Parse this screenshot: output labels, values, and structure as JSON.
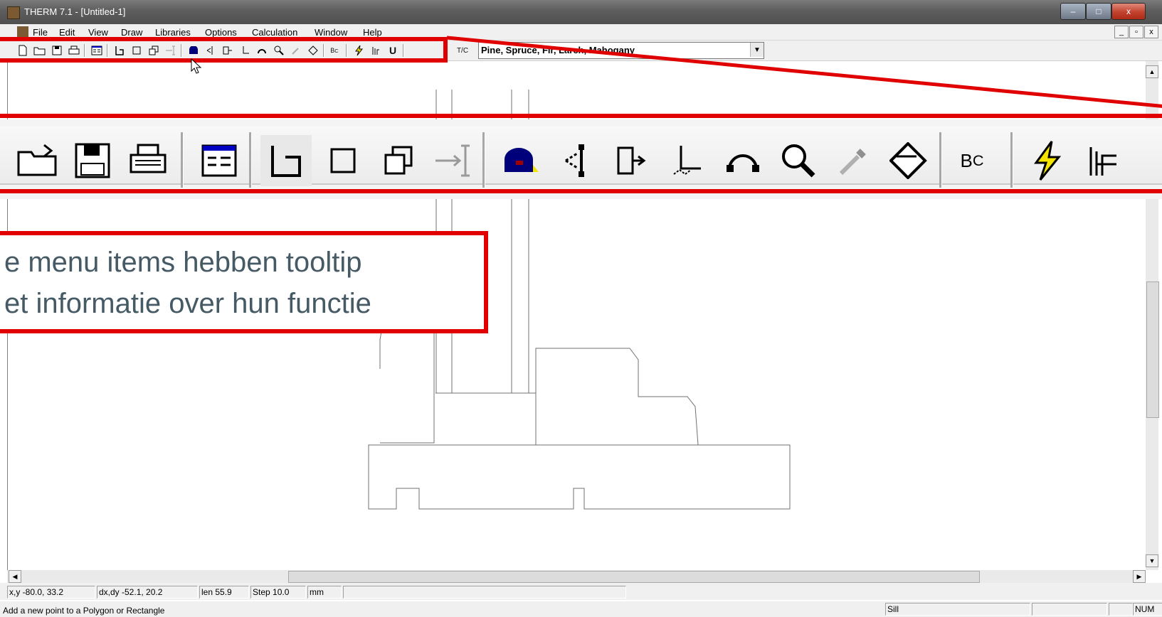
{
  "window": {
    "title": "THERM 7.1 - [Untitled-1]",
    "controls": {
      "minimize": "–",
      "maximize": "□",
      "close": "x"
    },
    "mdi_controls": {
      "minimize": "_",
      "restore": "▫",
      "close": "x"
    }
  },
  "menu": [
    {
      "label": "File"
    },
    {
      "label": "Edit"
    },
    {
      "label": "View"
    },
    {
      "label": "Draw"
    },
    {
      "label": "Libraries"
    },
    {
      "label": "Options"
    },
    {
      "label": "Calculation"
    },
    {
      "label": "Window"
    },
    {
      "label": "Help"
    }
  ],
  "toolbar": {
    "material_selected": "Pine, Spruce, Fir, Larch, Mahogany",
    "temp_label": "T/C",
    "bc_label": "B",
    "bc_sub": "C",
    "u_label": "U"
  },
  "callout": {
    "tooltip_lines": [
      "e menu items hebben tooltip",
      "et informatie over hun functie"
    ]
  },
  "status": {
    "xy": "x,y -80.0, 33.2",
    "dxdy": "dx,dy -52.1, 20.2",
    "len": "len  55.9",
    "step": "Step  10.0",
    "units": "mm",
    "help_text": "Add a new point to a Polygon or Rectangle",
    "mode": "Sill",
    "num": "NUM"
  },
  "colors": {
    "callout_red": "#e00000",
    "callout_text": "#455a64",
    "titlebar": "#5d5d5d"
  }
}
